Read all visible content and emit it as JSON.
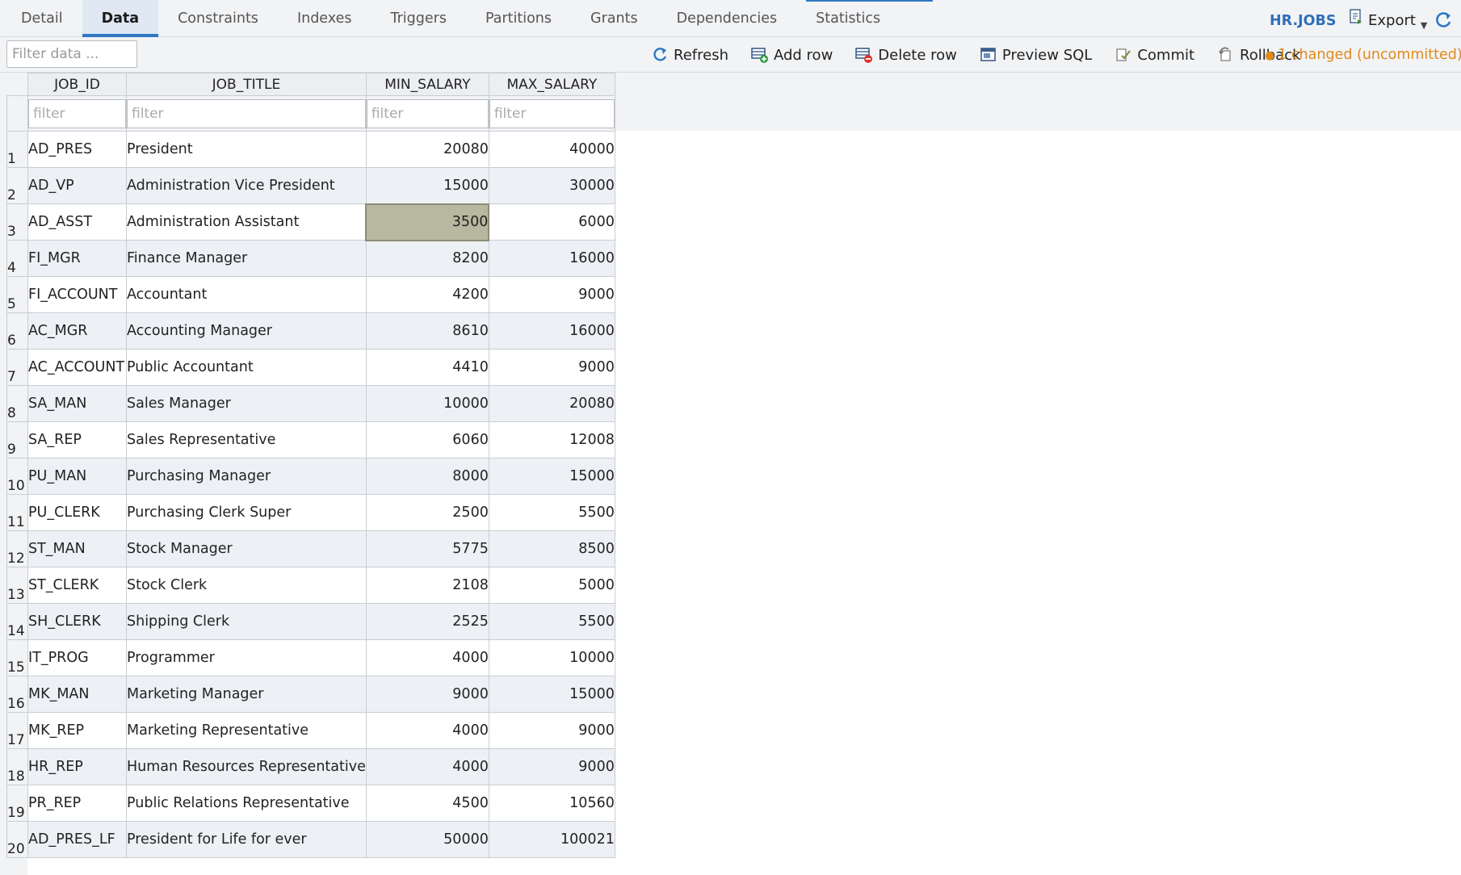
{
  "tabs": [
    {
      "label": "Detail"
    },
    {
      "label": "Data"
    },
    {
      "label": "Constraints"
    },
    {
      "label": "Indexes"
    },
    {
      "label": "Triggers"
    },
    {
      "label": "Partitions"
    },
    {
      "label": "Grants"
    },
    {
      "label": "Dependencies"
    },
    {
      "label": "Statistics"
    }
  ],
  "active_tab": "Data",
  "object_name": "HR.JOBS",
  "export_label": "Export",
  "toolbar": {
    "filter_placeholder": "Filter data ...",
    "refresh_label": "Refresh",
    "add_row_label": "Add row",
    "delete_row_label": "Delete row",
    "preview_sql_label": "Preview SQL",
    "commit_label": "Commit",
    "rollback_label": "Rollback",
    "status_text": "1 changed (uncommitted)"
  },
  "colors": {
    "accent": "#2f78c4",
    "status": "#e08a1e",
    "changed_cell": "#b8b7a0"
  },
  "grid": {
    "columns": [
      "JOB_ID",
      "JOB_TITLE",
      "MIN_SALARY",
      "MAX_SALARY"
    ],
    "filter_placeholder": "filter",
    "changed_cell": {
      "row": 3,
      "column": "MIN_SALARY"
    },
    "rows": [
      {
        "n": "1",
        "job_id": "AD_PRES",
        "job_title": "President",
        "min_salary": "20080",
        "max_salary": "40000"
      },
      {
        "n": "2",
        "job_id": "AD_VP",
        "job_title": "Administration Vice President",
        "min_salary": "15000",
        "max_salary": "30000"
      },
      {
        "n": "3",
        "job_id": "AD_ASST",
        "job_title": "Administration Assistant",
        "min_salary": "3500",
        "max_salary": "6000"
      },
      {
        "n": "4",
        "job_id": "FI_MGR",
        "job_title": "Finance Manager",
        "min_salary": "8200",
        "max_salary": "16000"
      },
      {
        "n": "5",
        "job_id": "FI_ACCOUNT",
        "job_title": "Accountant",
        "min_salary": "4200",
        "max_salary": "9000"
      },
      {
        "n": "6",
        "job_id": "AC_MGR",
        "job_title": "Accounting Manager",
        "min_salary": "8610",
        "max_salary": "16000"
      },
      {
        "n": "7",
        "job_id": "AC_ACCOUNT",
        "job_title": "Public Accountant",
        "min_salary": "4410",
        "max_salary": "9000"
      },
      {
        "n": "8",
        "job_id": "SA_MAN",
        "job_title": "Sales Manager",
        "min_salary": "10000",
        "max_salary": "20080"
      },
      {
        "n": "9",
        "job_id": "SA_REP",
        "job_title": "Sales Representative",
        "min_salary": "6060",
        "max_salary": "12008"
      },
      {
        "n": "10",
        "job_id": "PU_MAN",
        "job_title": "Purchasing Manager",
        "min_salary": "8000",
        "max_salary": "15000"
      },
      {
        "n": "11",
        "job_id": "PU_CLERK",
        "job_title": "Purchasing Clerk Super",
        "min_salary": "2500",
        "max_salary": "5500"
      },
      {
        "n": "12",
        "job_id": "ST_MAN",
        "job_title": "Stock Manager",
        "min_salary": "5775",
        "max_salary": "8500"
      },
      {
        "n": "13",
        "job_id": "ST_CLERK",
        "job_title": "Stock Clerk",
        "min_salary": "2108",
        "max_salary": "5000"
      },
      {
        "n": "14",
        "job_id": "SH_CLERK",
        "job_title": "Shipping Clerk",
        "min_salary": "2525",
        "max_salary": "5500"
      },
      {
        "n": "15",
        "job_id": "IT_PROG",
        "job_title": "Programmer",
        "min_salary": "4000",
        "max_salary": "10000"
      },
      {
        "n": "16",
        "job_id": "MK_MAN",
        "job_title": "Marketing Manager",
        "min_salary": "9000",
        "max_salary": "15000"
      },
      {
        "n": "17",
        "job_id": "MK_REP",
        "job_title": "Marketing Representative",
        "min_salary": "4000",
        "max_salary": "9000"
      },
      {
        "n": "18",
        "job_id": "HR_REP",
        "job_title": "Human Resources Representative",
        "min_salary": "4000",
        "max_salary": "9000"
      },
      {
        "n": "19",
        "job_id": "PR_REP",
        "job_title": "Public Relations Representative",
        "min_salary": "4500",
        "max_salary": "10560"
      },
      {
        "n": "20",
        "job_id": "AD_PRES_LF",
        "job_title": "President for Life for ever",
        "min_salary": "50000",
        "max_salary": "100021"
      }
    ]
  }
}
